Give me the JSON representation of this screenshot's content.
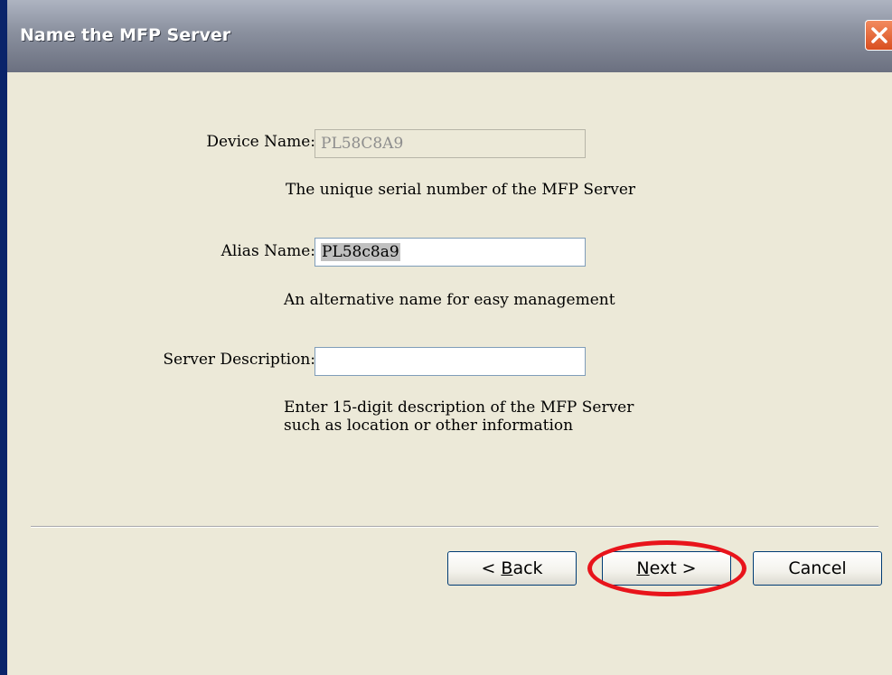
{
  "window": {
    "title": "Name the MFP Server"
  },
  "form": {
    "device_name": {
      "label": "Device Name:",
      "value": "PL58C8A9",
      "hint": "The unique serial number of the MFP Server"
    },
    "alias_name": {
      "label": "Alias Name:",
      "value": "PL58c8a9",
      "hint": "An alternative name for easy management"
    },
    "server_description": {
      "label": "Server Description:",
      "value": "",
      "hint_line1": "Enter 15-digit description of the MFP Server",
      "hint_line2": "such as location or other information"
    }
  },
  "buttons": {
    "back": {
      "prefix": "< ",
      "mnemonic": "B",
      "rest": "ack"
    },
    "next": {
      "mnemonic": "N",
      "rest": "ext >"
    },
    "cancel": "Cancel"
  },
  "colors": {
    "highlight_ring": "#e8141b",
    "close_button": "#d94f20"
  }
}
